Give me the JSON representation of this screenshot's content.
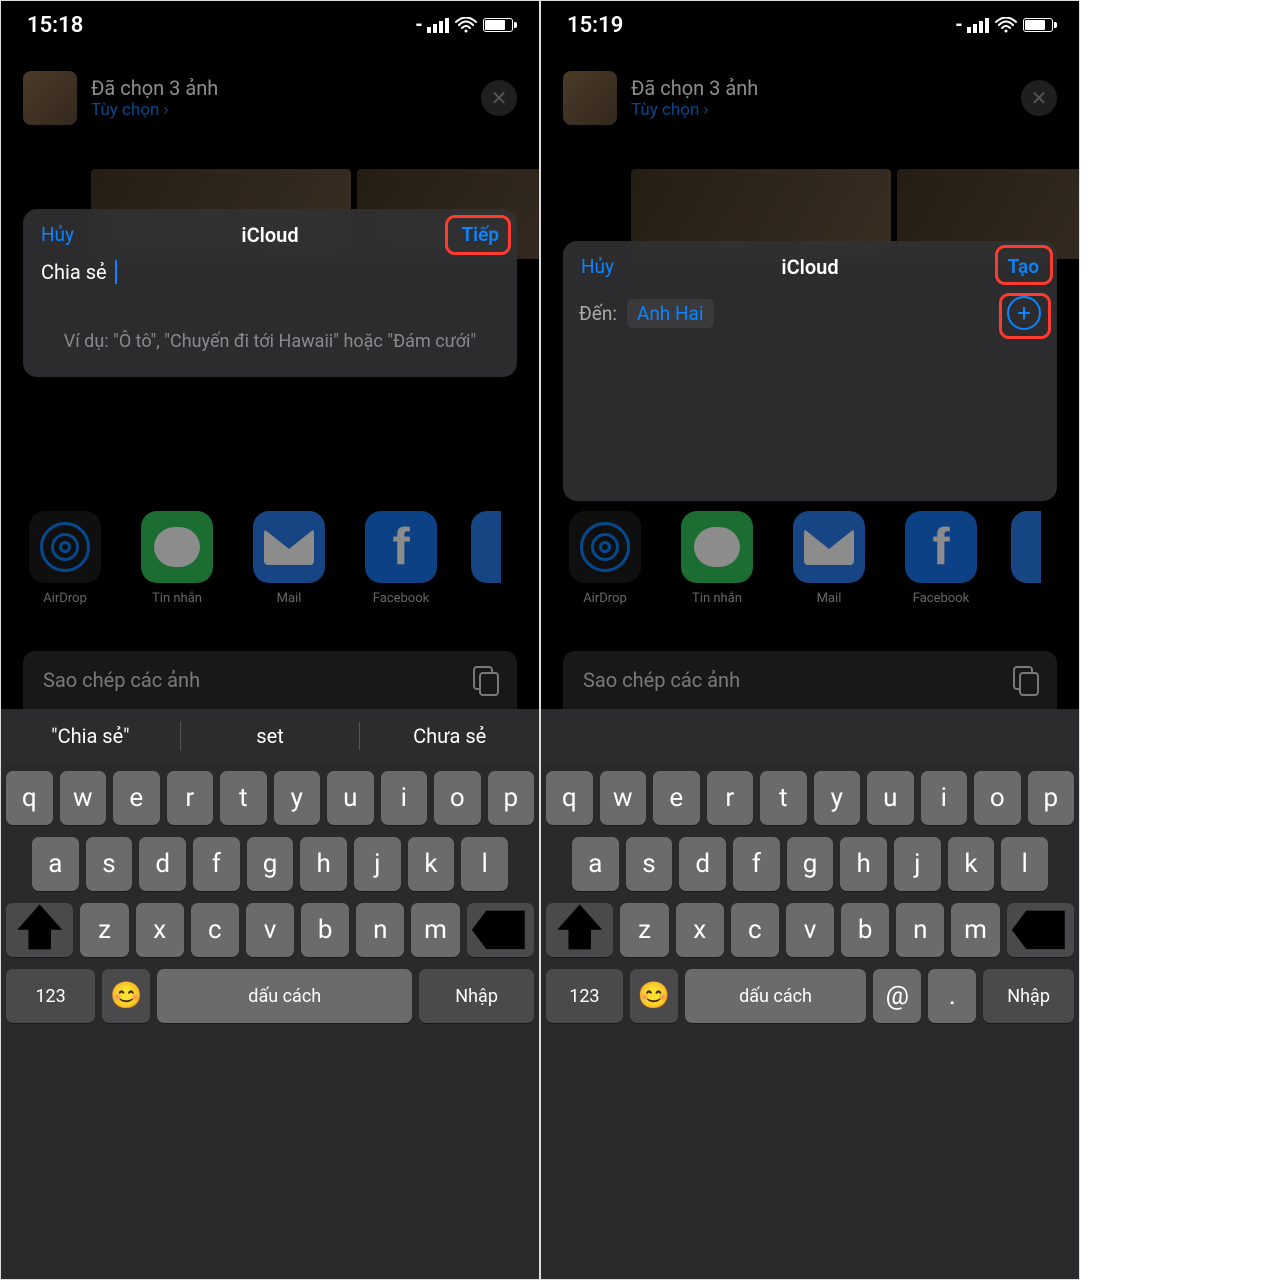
{
  "left": {
    "time": "15:18",
    "share_title": "Đã chọn 3 ảnh",
    "share_sub": "Tùy chọn ›",
    "card": {
      "cancel": "Hủy",
      "title": "iCloud",
      "action": "Tiếp",
      "value": "Chia sẻ",
      "hint": "Ví dụ: \"Ô tô\", \"Chuyến đi tới Hawaii\" hoặc \"Đám cưới\""
    },
    "apps": [
      "AirDrop",
      "Tin nhắn",
      "Mail",
      "Facebook"
    ],
    "copy": "Sao chép các ảnh",
    "sugg": [
      "\"Chia sẻ\"",
      "set",
      "Chưa sẻ"
    ],
    "kbd": {
      "r1": [
        "q",
        "w",
        "e",
        "r",
        "t",
        "y",
        "u",
        "i",
        "o",
        "p"
      ],
      "r2": [
        "a",
        "s",
        "d",
        "f",
        "g",
        "h",
        "j",
        "k",
        "l"
      ],
      "r3": [
        "z",
        "x",
        "c",
        "v",
        "b",
        "n",
        "m"
      ],
      "num": "123",
      "space": "dấu cách",
      "ret": "Nhập"
    }
  },
  "right": {
    "time": "15:19",
    "share_title": "Đã chọn 3 ảnh",
    "share_sub": "Tùy chọn ›",
    "card": {
      "cancel": "Hủy",
      "title": "iCloud",
      "action": "Tạo",
      "to_label": "Đến:",
      "to_value": "Anh Hai"
    },
    "apps": [
      "AirDrop",
      "Tin nhắn",
      "Mail",
      "Facebook"
    ],
    "copy": "Sao chép các ảnh",
    "kbd": {
      "r1": [
        "q",
        "w",
        "e",
        "r",
        "t",
        "y",
        "u",
        "i",
        "o",
        "p"
      ],
      "r2": [
        "a",
        "s",
        "d",
        "f",
        "g",
        "h",
        "j",
        "k",
        "l"
      ],
      "r3": [
        "z",
        "x",
        "c",
        "v",
        "b",
        "n",
        "m"
      ],
      "num": "123",
      "space": "dấu cách",
      "at": "@",
      "dot": ".",
      "ret": "Nhập"
    }
  }
}
